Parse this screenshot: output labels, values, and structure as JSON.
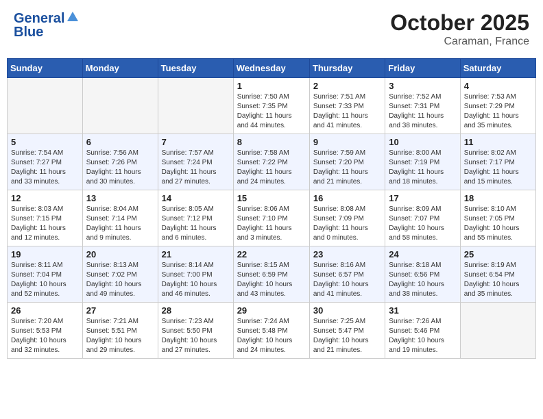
{
  "header": {
    "logo_line1": "General",
    "logo_line2": "Blue",
    "month": "October 2025",
    "location": "Caraman, France"
  },
  "weekdays": [
    "Sunday",
    "Monday",
    "Tuesday",
    "Wednesday",
    "Thursday",
    "Friday",
    "Saturday"
  ],
  "weeks": [
    [
      {
        "day": "",
        "info": ""
      },
      {
        "day": "",
        "info": ""
      },
      {
        "day": "",
        "info": ""
      },
      {
        "day": "1",
        "info": "Sunrise: 7:50 AM\nSunset: 7:35 PM\nDaylight: 11 hours\nand 44 minutes."
      },
      {
        "day": "2",
        "info": "Sunrise: 7:51 AM\nSunset: 7:33 PM\nDaylight: 11 hours\nand 41 minutes."
      },
      {
        "day": "3",
        "info": "Sunrise: 7:52 AM\nSunset: 7:31 PM\nDaylight: 11 hours\nand 38 minutes."
      },
      {
        "day": "4",
        "info": "Sunrise: 7:53 AM\nSunset: 7:29 PM\nDaylight: 11 hours\nand 35 minutes."
      }
    ],
    [
      {
        "day": "5",
        "info": "Sunrise: 7:54 AM\nSunset: 7:27 PM\nDaylight: 11 hours\nand 33 minutes."
      },
      {
        "day": "6",
        "info": "Sunrise: 7:56 AM\nSunset: 7:26 PM\nDaylight: 11 hours\nand 30 minutes."
      },
      {
        "day": "7",
        "info": "Sunrise: 7:57 AM\nSunset: 7:24 PM\nDaylight: 11 hours\nand 27 minutes."
      },
      {
        "day": "8",
        "info": "Sunrise: 7:58 AM\nSunset: 7:22 PM\nDaylight: 11 hours\nand 24 minutes."
      },
      {
        "day": "9",
        "info": "Sunrise: 7:59 AM\nSunset: 7:20 PM\nDaylight: 11 hours\nand 21 minutes."
      },
      {
        "day": "10",
        "info": "Sunrise: 8:00 AM\nSunset: 7:19 PM\nDaylight: 11 hours\nand 18 minutes."
      },
      {
        "day": "11",
        "info": "Sunrise: 8:02 AM\nSunset: 7:17 PM\nDaylight: 11 hours\nand 15 minutes."
      }
    ],
    [
      {
        "day": "12",
        "info": "Sunrise: 8:03 AM\nSunset: 7:15 PM\nDaylight: 11 hours\nand 12 minutes."
      },
      {
        "day": "13",
        "info": "Sunrise: 8:04 AM\nSunset: 7:14 PM\nDaylight: 11 hours\nand 9 minutes."
      },
      {
        "day": "14",
        "info": "Sunrise: 8:05 AM\nSunset: 7:12 PM\nDaylight: 11 hours\nand 6 minutes."
      },
      {
        "day": "15",
        "info": "Sunrise: 8:06 AM\nSunset: 7:10 PM\nDaylight: 11 hours\nand 3 minutes."
      },
      {
        "day": "16",
        "info": "Sunrise: 8:08 AM\nSunset: 7:09 PM\nDaylight: 11 hours\nand 0 minutes."
      },
      {
        "day": "17",
        "info": "Sunrise: 8:09 AM\nSunset: 7:07 PM\nDaylight: 10 hours\nand 58 minutes."
      },
      {
        "day": "18",
        "info": "Sunrise: 8:10 AM\nSunset: 7:05 PM\nDaylight: 10 hours\nand 55 minutes."
      }
    ],
    [
      {
        "day": "19",
        "info": "Sunrise: 8:11 AM\nSunset: 7:04 PM\nDaylight: 10 hours\nand 52 minutes."
      },
      {
        "day": "20",
        "info": "Sunrise: 8:13 AM\nSunset: 7:02 PM\nDaylight: 10 hours\nand 49 minutes."
      },
      {
        "day": "21",
        "info": "Sunrise: 8:14 AM\nSunset: 7:00 PM\nDaylight: 10 hours\nand 46 minutes."
      },
      {
        "day": "22",
        "info": "Sunrise: 8:15 AM\nSunset: 6:59 PM\nDaylight: 10 hours\nand 43 minutes."
      },
      {
        "day": "23",
        "info": "Sunrise: 8:16 AM\nSunset: 6:57 PM\nDaylight: 10 hours\nand 41 minutes."
      },
      {
        "day": "24",
        "info": "Sunrise: 8:18 AM\nSunset: 6:56 PM\nDaylight: 10 hours\nand 38 minutes."
      },
      {
        "day": "25",
        "info": "Sunrise: 8:19 AM\nSunset: 6:54 PM\nDaylight: 10 hours\nand 35 minutes."
      }
    ],
    [
      {
        "day": "26",
        "info": "Sunrise: 7:20 AM\nSunset: 5:53 PM\nDaylight: 10 hours\nand 32 minutes."
      },
      {
        "day": "27",
        "info": "Sunrise: 7:21 AM\nSunset: 5:51 PM\nDaylight: 10 hours\nand 29 minutes."
      },
      {
        "day": "28",
        "info": "Sunrise: 7:23 AM\nSunset: 5:50 PM\nDaylight: 10 hours\nand 27 minutes."
      },
      {
        "day": "29",
        "info": "Sunrise: 7:24 AM\nSunset: 5:48 PM\nDaylight: 10 hours\nand 24 minutes."
      },
      {
        "day": "30",
        "info": "Sunrise: 7:25 AM\nSunset: 5:47 PM\nDaylight: 10 hours\nand 21 minutes."
      },
      {
        "day": "31",
        "info": "Sunrise: 7:26 AM\nSunset: 5:46 PM\nDaylight: 10 hours\nand 19 minutes."
      },
      {
        "day": "",
        "info": ""
      }
    ]
  ]
}
